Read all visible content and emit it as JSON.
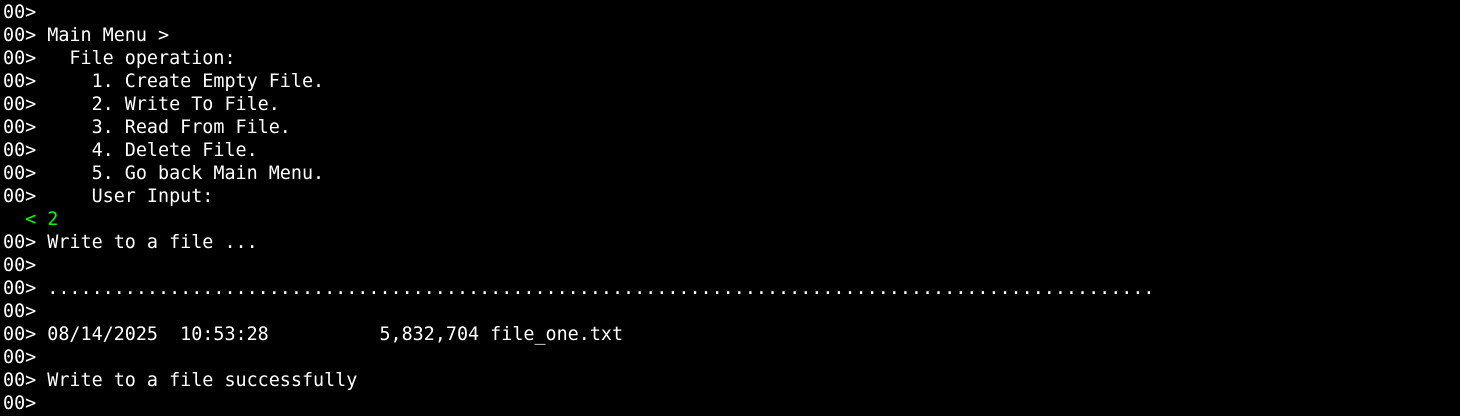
{
  "terminal": {
    "colors": {
      "background": "#000000",
      "text": "#ffffff",
      "input": "#00ff00"
    },
    "lines": [
      {
        "text": "00>",
        "kind": "output"
      },
      {
        "text": "00> Main Menu >",
        "kind": "output"
      },
      {
        "text": "00>   File operation:",
        "kind": "output"
      },
      {
        "text": "00>     1. Create Empty File.",
        "kind": "output"
      },
      {
        "text": "00>     2. Write To File.",
        "kind": "output"
      },
      {
        "text": "00>     3. Read From File.",
        "kind": "output"
      },
      {
        "text": "00>     4. Delete File.",
        "kind": "output"
      },
      {
        "text": "00>     5. Go back Main Menu.",
        "kind": "output"
      },
      {
        "text": "00>     User Input:",
        "kind": "output"
      },
      {
        "text": "  < 2",
        "kind": "input"
      },
      {
        "text": "00> Write to a file ...",
        "kind": "output"
      },
      {
        "text": "00>",
        "kind": "output"
      },
      {
        "text": "00> ....................................................................................................",
        "kind": "output"
      },
      {
        "text": "00>",
        "kind": "output"
      },
      {
        "text": "00> 08/14/2025  10:53:28          5,832,704 file_one.txt",
        "kind": "output"
      },
      {
        "text": "00>",
        "kind": "output"
      },
      {
        "text": "00> Write to a file successfully",
        "kind": "output"
      },
      {
        "text": "00>",
        "kind": "output"
      }
    ]
  }
}
